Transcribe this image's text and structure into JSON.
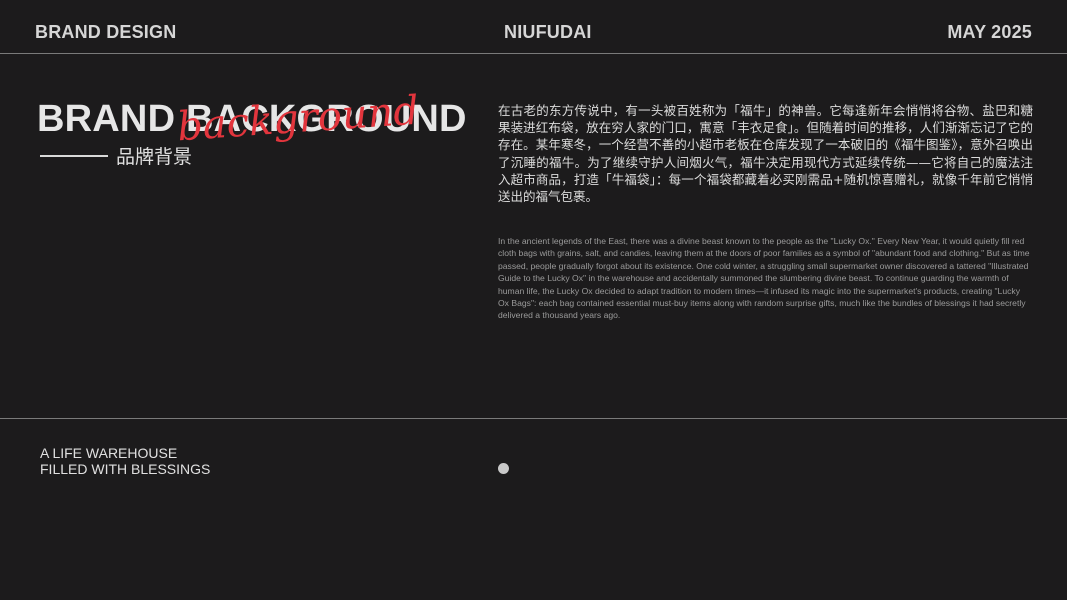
{
  "header": {
    "left": "BRAND DESIGN",
    "center": "NIUFUDAI",
    "right": "MAY 2025"
  },
  "title": {
    "main": "BRAND BACKGROUND",
    "script": "background",
    "subtitle_cn": "品牌背景"
  },
  "body": {
    "cn": "在古老的东方传说中，有一头被百姓称为「福牛」的神兽。它每逢新年会悄悄将谷物、盐巴和糖果装进红布袋，放在穷人家的门口，寓意「丰衣足食」。但随着时间的推移，人们渐渐忘记了它的存在。某年寒冬，一个经营不善的小超市老板在仓库发现了一本破旧的《福牛图鉴》，意外召唤出了沉睡的福牛。为了继续守护人间烟火气，福牛决定用现代方式延续传统——它将自己的魔法注入超市商品，打造「牛福袋」：每一个福袋都藏着必买刚需品+随机惊喜赠礼，就像千年前它悄悄送出的福气包裹。",
    "en": "In the ancient legends of the East, there was a divine beast known to the people as the \"Lucky Ox.\" Every New Year, it would quietly fill red cloth bags with grains, salt, and candies, leaving them at the doors of poor families as a symbol of \"abundant food and clothing.\" But as time passed, people gradually forgot about its existence. One cold winter, a struggling small supermarket owner discovered a tattered \"Illustrated Guide to the Lucky Ox\" in the warehouse and accidentally summoned the slumbering divine beast. To continue guarding the warmth of human life, the Lucky Ox decided to adapt tradition to modern times—it infused its magic into the supermarket's products, creating \"Lucky Ox Bags\": each bag contained essential must-buy items along with random surprise gifts, much like the bundles of blessings it had secretly delivered a thousand years ago."
  },
  "footer": {
    "tagline_line1": "A LIFE WAREHOUSE",
    "tagline_line2": "FILLED WITH BLESSINGS"
  },
  "colors": {
    "background": "#1c1b1c",
    "accent": "#e2353d",
    "text": "#d9d9d9"
  }
}
